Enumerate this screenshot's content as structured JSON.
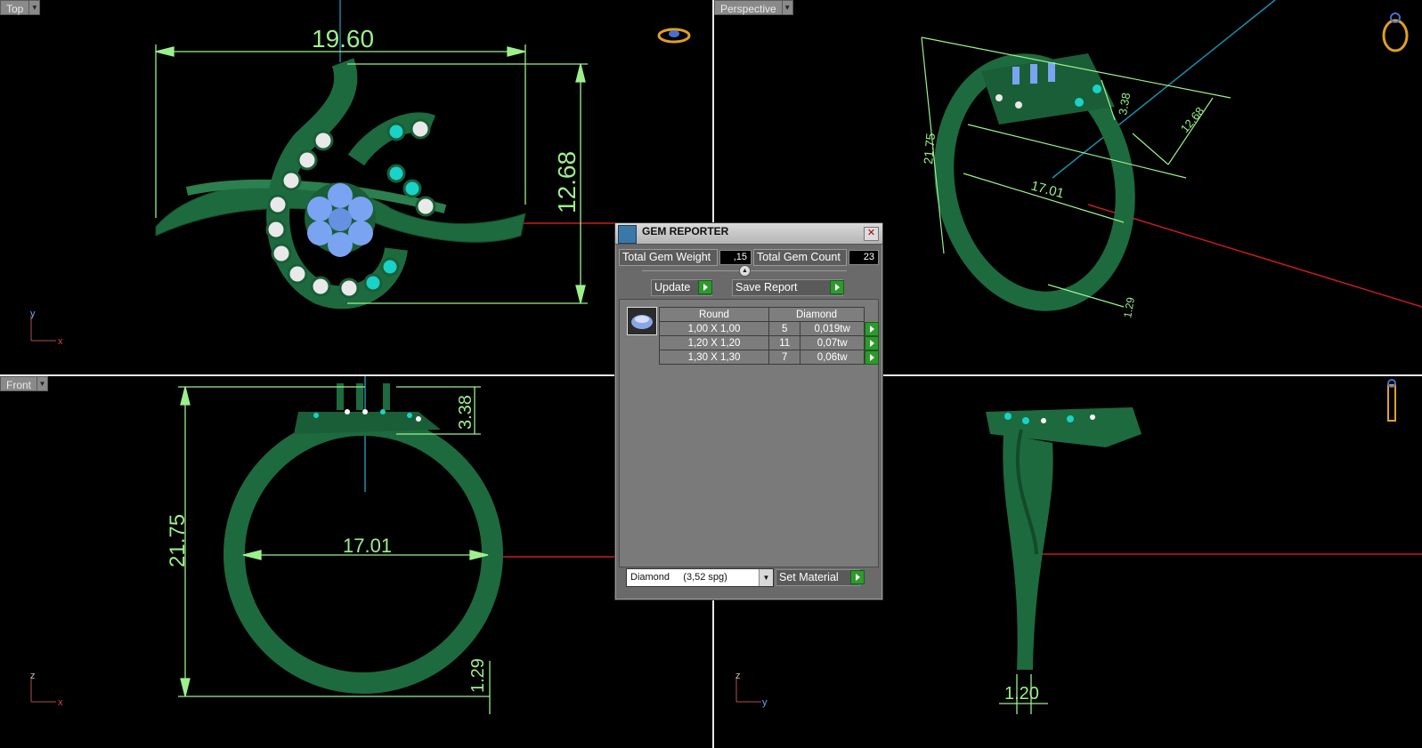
{
  "viewports": {
    "top": {
      "label": "Top",
      "dim_width": "19.60",
      "dim_height": "12.68",
      "axis_v": "y",
      "axis_h": "x"
    },
    "perspective": {
      "label": "Perspective",
      "dim_a": "21.75",
      "dim_b": "17.01",
      "dim_c": "12.68",
      "dim_d": "3.38",
      "dim_e": "1.29"
    },
    "front": {
      "label": "Front",
      "dim_height": "21.75",
      "dim_top": "3.38",
      "dim_inner": "17.01",
      "dim_bottom": "1.29",
      "axis_v": "z",
      "axis_h": "x"
    },
    "side": {
      "dim_bottom": "1.20",
      "axis_v": "z",
      "axis_h": "y"
    }
  },
  "gem_reporter": {
    "title": "GEM REPORTER",
    "total_weight_label": "Total Gem Weight",
    "total_weight_value": ",15",
    "total_count_label": "Total Gem Count",
    "total_count_value": "23",
    "update_label": "Update",
    "save_label": "Save Report",
    "table": {
      "headers": [
        "Round",
        "Diamond"
      ],
      "rows": [
        {
          "size": "1,00 X 1,00",
          "count": "5",
          "weight": "0,019tw"
        },
        {
          "size": "1,20 X 1,20",
          "count": "11",
          "weight": "0,07tw"
        },
        {
          "size": "1,30 X 1,30",
          "count": "7",
          "weight": "0,06tw"
        }
      ]
    },
    "material_value": "Diamond     (3,52 spg)",
    "set_material_label": "Set Material"
  },
  "colors": {
    "ring": "#1f6b3f",
    "ring_dark": "#124a2a",
    "dim": "#9cf08c",
    "accent_blue": "#6fa0f0",
    "accent_cyan": "#19d2c8"
  }
}
